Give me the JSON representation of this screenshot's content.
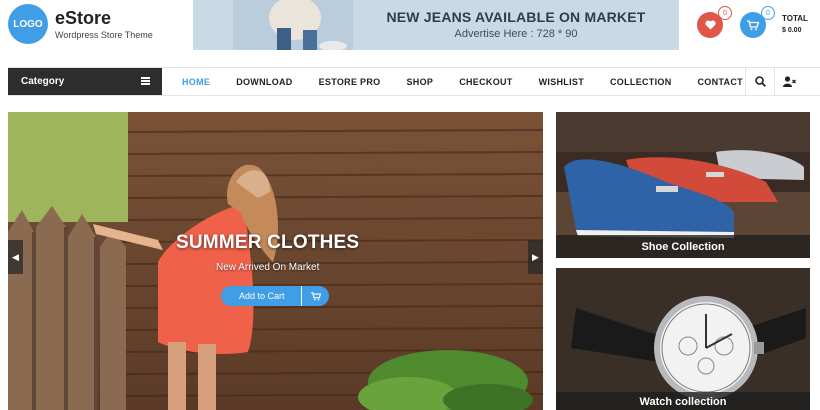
{
  "header": {
    "logo_text": "LOGO",
    "site_title": "eStore",
    "tagline": "Wordpress Store Theme",
    "ad_title": "NEW JEANS AVAILABLE ON MARKET",
    "ad_subtitle": "Advertise Here : 728 * 90",
    "wishlist_count": "0",
    "cart_count": "0",
    "total_label": "TOTAL",
    "total_value": "$ 0.00"
  },
  "nav": {
    "category_label": "Category",
    "items": [
      {
        "label": "HOME",
        "active": true
      },
      {
        "label": "DOWNLOAD"
      },
      {
        "label": "ESTORE PRO"
      },
      {
        "label": "SHOP"
      },
      {
        "label": "CHECKOUT"
      },
      {
        "label": "WISHLIST"
      },
      {
        "label": "COLLECTION"
      },
      {
        "label": "CONTACT"
      }
    ]
  },
  "slider": {
    "title": "SUMMER CLOTHES",
    "subtitle": "New Arrived On Market",
    "button_label": "Add to Cart"
  },
  "cards": [
    {
      "label": "Shoe Collection"
    },
    {
      "label": "Watch collection"
    }
  ],
  "colors": {
    "accent": "#3f9ee6",
    "heart": "#e05649",
    "category_bg": "#2d2d2d"
  },
  "icons": [
    "search-icon",
    "user-icon",
    "heart-icon",
    "cart-icon",
    "menu-icon",
    "chevron-left-icon",
    "chevron-right-icon"
  ]
}
